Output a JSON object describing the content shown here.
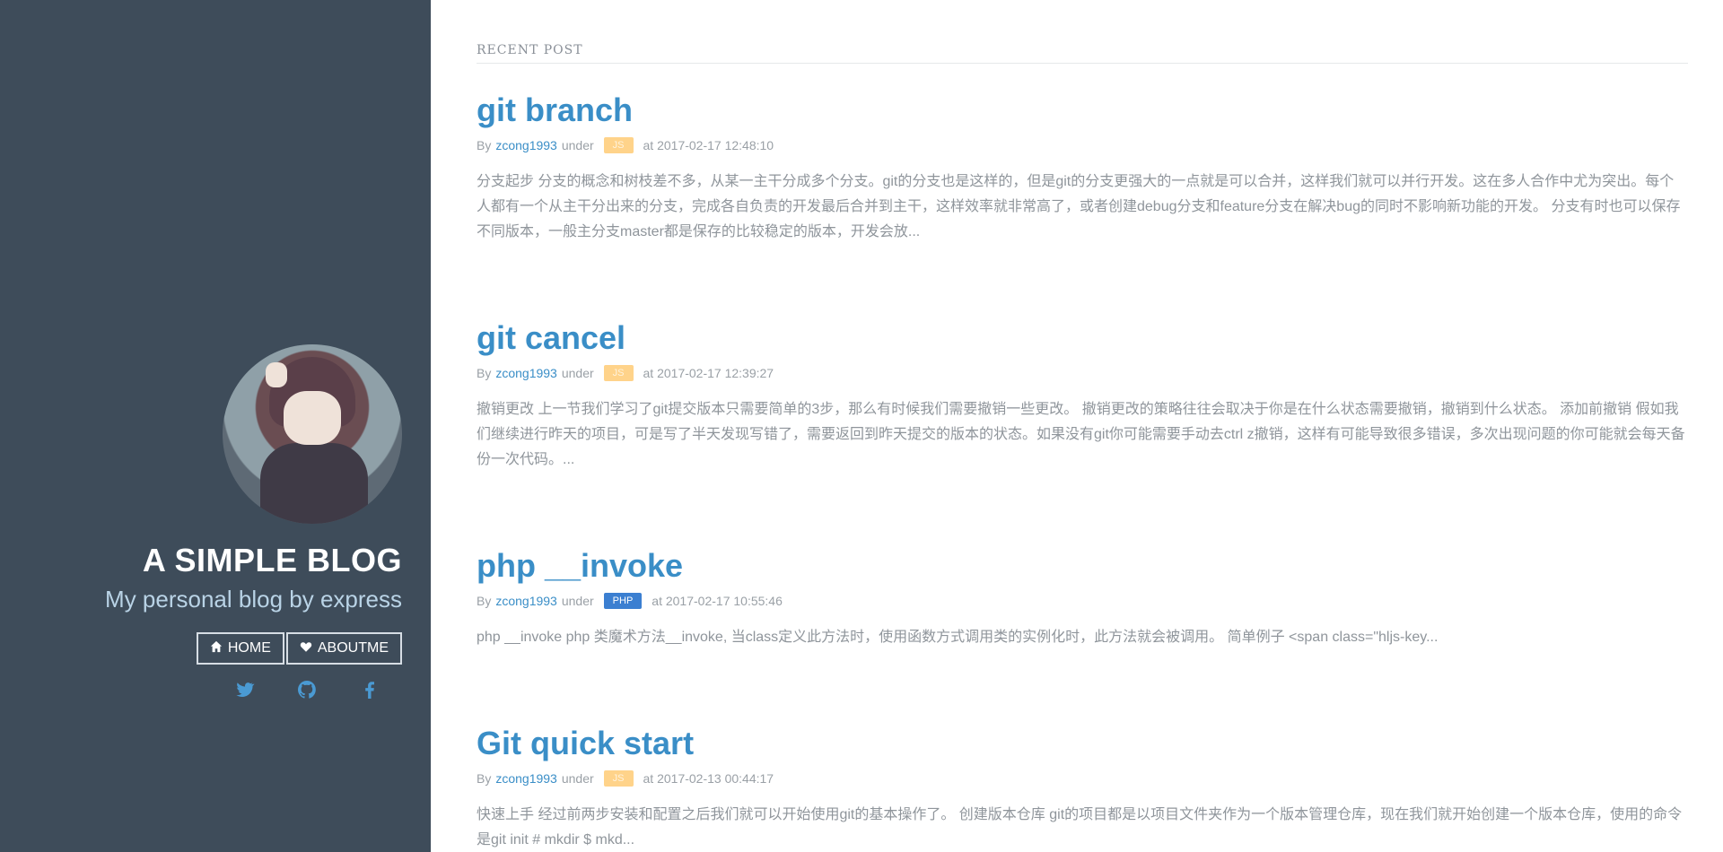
{
  "sidebar": {
    "title": "A SIMPLE BLOG",
    "tagline": "My personal blog by express",
    "nav": [
      {
        "label": "HOME",
        "icon": "home-icon"
      },
      {
        "label": "ABOUTME",
        "icon": "heart-icon"
      }
    ],
    "social": [
      {
        "icon": "twitter-icon"
      },
      {
        "icon": "github-icon"
      },
      {
        "icon": "facebook-icon"
      }
    ]
  },
  "main": {
    "section_title": "RECENT POST",
    "posts": [
      {
        "title": "git branch",
        "by": "By",
        "author": "zcong1993",
        "under": "under",
        "tag": "JS",
        "at": "at 2017-02-17 12:48:10",
        "excerpt": "分支起步 分支的概念和树枝差不多，从某一主干分成多个分支。git的分支也是这样的，但是git的分支更强大的一点就是可以合并，这样我们就可以并行开发。这在多人合作中尤为突出。每个人都有一个从主干分出来的分支，完成各自负责的开发最后合并到主干，这样效率就非常高了，或者创建debug分支和feature分支在解决bug的同时不影响新功能的开发。 分支有时也可以保存不同版本，一般主分支master都是保存的比较稳定的版本，开发会放..."
      },
      {
        "title": "git cancel",
        "by": "By",
        "author": "zcong1993",
        "under": "under",
        "tag": "JS",
        "at": "at 2017-02-17 12:39:27",
        "excerpt": "撤销更改 上一节我们学习了git提交版本只需要简单的3步，那么有时候我们需要撤销一些更改。 撤销更改的策略往往会取决于你是在什么状态需要撤销，撤销到什么状态。 添加前撤销 假如我们继续进行昨天的项目，可是写了半天发现写错了，需要返回到昨天提交的版本的状态。如果没有git你可能需要手动去ctrl z撤销，这样有可能导致很多错误，多次出现问题的你可能就会每天备份一次代码。..."
      },
      {
        "title": "php __invoke",
        "by": "By",
        "author": "zcong1993",
        "under": "under",
        "tag": "PHP",
        "at": "at 2017-02-17 10:55:46",
        "excerpt": "php __invoke php 类魔术方法__invoke, 当class定义此方法时，使用函数方式调用类的实例化时，此方法就会被调用。 简单例子 <span class=\"hljs-key..."
      },
      {
        "title": "Git quick start",
        "by": "By",
        "author": "zcong1993",
        "under": "under",
        "tag": "JS",
        "at": "at 2017-02-13 00:44:17",
        "excerpt": "快速上手 经过前两步安装和配置之后我们就可以开始使用git的基本操作了。 创建版本仓库 git的项目都是以项目文件夹作为一个版本管理仓库，现在我们就开始创建一个版本仓库，使用的命令是git init    # mkdir $ mkd..."
      }
    ]
  },
  "colors": {
    "sidebar_bg": "#3e4c5a",
    "accent": "#3a8ec7",
    "tag_js": "#ffd38a",
    "tag_php": "#3b7fd1"
  }
}
